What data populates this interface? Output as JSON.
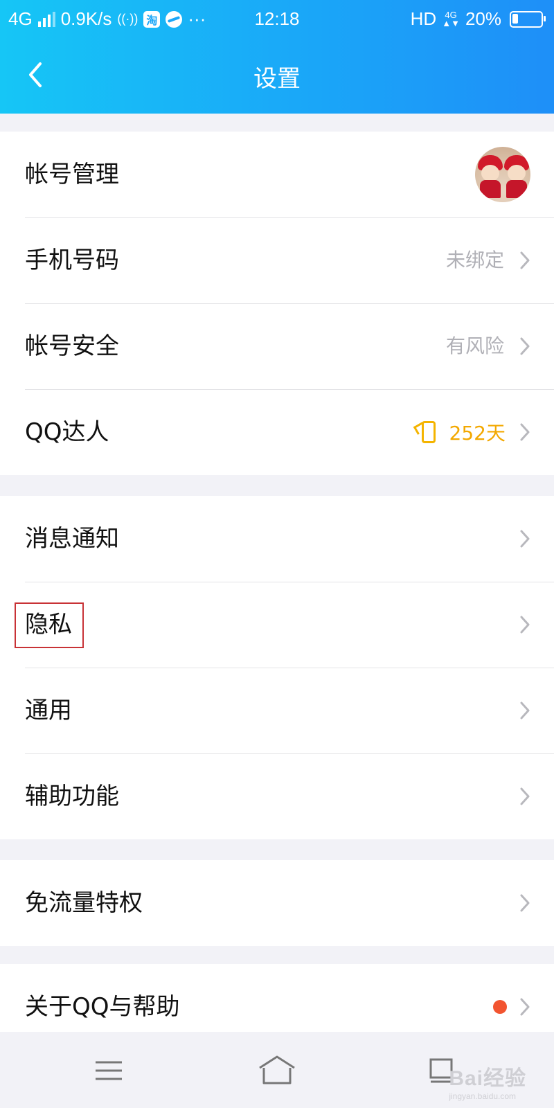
{
  "status_bar": {
    "network": "4G",
    "speed": "0.9K/s",
    "taobao_icon_text": "淘",
    "more": "···",
    "time": "12:18",
    "hd": "HD",
    "net_small": "4G",
    "battery": "20%"
  },
  "header": {
    "title": "设置",
    "back_icon": "chevron-left-icon"
  },
  "groups": [
    {
      "rows": [
        {
          "label": "帐号管理",
          "value": "",
          "trailing": "avatar"
        },
        {
          "label": "手机号码",
          "value": "未绑定",
          "trailing": "chevron"
        },
        {
          "label": "帐号安全",
          "value": "有风险",
          "trailing": "chevron"
        },
        {
          "label": "QQ达人",
          "value": "252天",
          "trailing": "chevron"
        }
      ]
    },
    {
      "rows": [
        {
          "label": "消息通知",
          "trailing": "chevron"
        },
        {
          "label": "隐私",
          "trailing": "chevron",
          "highlighted": true
        },
        {
          "label": "通用",
          "trailing": "chevron"
        },
        {
          "label": "辅助功能",
          "trailing": "chevron"
        }
      ]
    },
    {
      "rows": [
        {
          "label": "免流量特权",
          "trailing": "chevron"
        }
      ]
    },
    {
      "rows": [
        {
          "label": "关于QQ与帮助",
          "trailing": "chevron",
          "badge": "red-dot"
        }
      ]
    }
  ],
  "nav": {
    "menu_icon": "menu-icon",
    "home_icon": "home-icon",
    "back_icon": "back-icon"
  },
  "watermark": {
    "text": "Bai经验",
    "sub": "jingyan.baidu.com"
  },
  "colors": {
    "header_start": "#16c6f6",
    "header_end": "#1e8ff8",
    "highlight": "#c83236",
    "badge": "#f25430",
    "vip": "#f3a800"
  }
}
